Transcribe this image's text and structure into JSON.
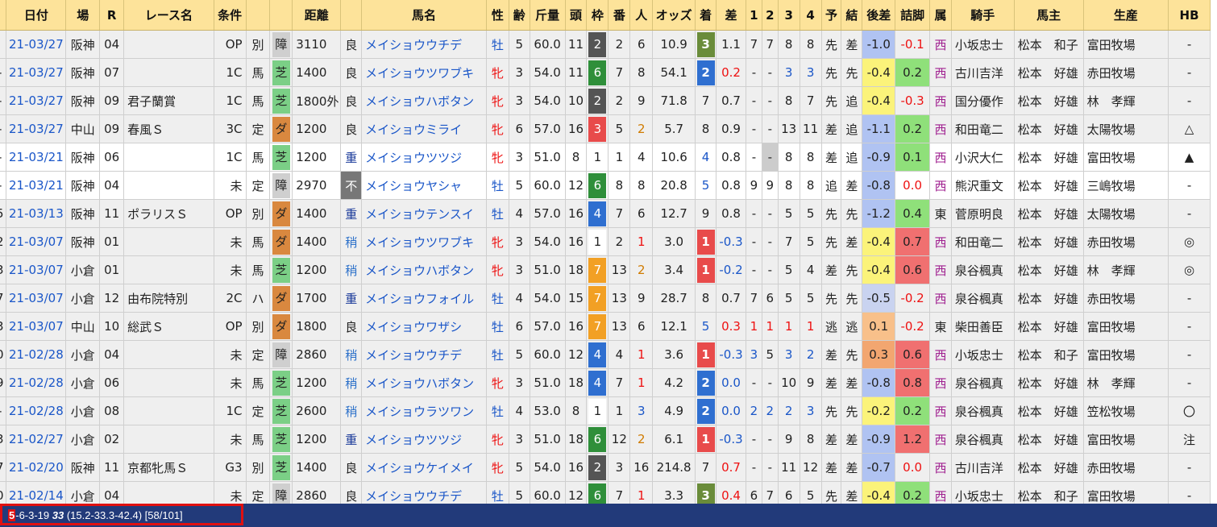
{
  "headers": [
    "",
    "日付",
    "場",
    "R",
    "レース名",
    "条件",
    "",
    "",
    "距離",
    "",
    "馬名",
    "性",
    "齢",
    "斤量",
    "頭",
    "枠",
    "番",
    "人",
    "オッズ",
    "着",
    "差",
    "1",
    "2",
    "3",
    "4",
    "予",
    "結",
    "後差",
    "詰脚",
    "属",
    "騎手",
    "馬主",
    "生産",
    "HB"
  ],
  "colors": {
    "header_bg": "#fde39a",
    "status_bar": "#223a7a",
    "highlight_box": "#e01010",
    "link": "#1a56c8"
  },
  "rows": [
    {
      "p": "",
      "d": "21-03/27",
      "v": "阪神",
      "r": "04",
      "n": "",
      "c": "OP",
      "w": "別",
      "tk": "障",
      "tkt": "jump",
      "dist": "3110",
      "g": "良",
      "h": "メイショウウチデ",
      "s": "牡",
      "a": "5",
      "wt": "60.0",
      "fs": "11",
      "wk": "2",
      "no": "2",
      "pop": "6",
      "odd": "10.9",
      "fin": "3",
      "mg": "1.1",
      "c1": "7",
      "c2": "7",
      "c3": "8",
      "c4": "8",
      "pr": "先",
      "rs": "差",
      "ls": "-1.0",
      "lc": "-0.1",
      "st": "西",
      "j": "小坂忠士",
      "o": "松本　和子",
      "b": "富田牧場",
      "hb": "-"
    },
    {
      "p": "-",
      "d": "21-03/27",
      "v": "阪神",
      "r": "07",
      "n": "",
      "c": "1C",
      "w": "馬",
      "tk": "芝",
      "tkt": "turf",
      "dist": "1400",
      "g": "良",
      "h": "メイショウツワブキ",
      "s": "牝",
      "a": "3",
      "wt": "54.0",
      "fs": "11",
      "wk": "6",
      "no": "7",
      "pop": "8",
      "odd": "54.1",
      "fin": "2",
      "mg": "0.2",
      "c1": "-",
      "c2": "-",
      "c3": "3",
      "c4": "3",
      "pr": "先",
      "rs": "先",
      "ls": "-0.4",
      "lc": "0.2",
      "st": "西",
      "j": "古川吉洋",
      "o": "松本　好雄",
      "b": "赤田牧場",
      "hb": "-"
    },
    {
      "p": "-",
      "d": "21-03/27",
      "v": "阪神",
      "r": "09",
      "n": "君子蘭賞",
      "c": "1C",
      "w": "馬",
      "tk": "芝",
      "tkt": "turf",
      "dist": "1800外",
      "g": "良",
      "h": "メイショウハボタン",
      "s": "牝",
      "a": "3",
      "wt": "54.0",
      "fs": "10",
      "wk": "2",
      "no": "2",
      "pop": "9",
      "odd": "71.8",
      "fin": "7",
      "mg": "0.7",
      "c1": "-",
      "c2": "-",
      "c3": "8",
      "c4": "7",
      "pr": "先",
      "rs": "追",
      "ls": "-0.4",
      "lc": "-0.3",
      "st": "西",
      "j": "国分優作",
      "o": "松本　好雄",
      "b": "林　孝輝",
      "hb": "-"
    },
    {
      "p": "-",
      "d": "21-03/27",
      "v": "中山",
      "r": "09",
      "n": "春風Ｓ",
      "c": "3C",
      "w": "定",
      "tk": "ダ",
      "tkt": "dirt",
      "dist": "1200",
      "g": "良",
      "h": "メイショウミライ",
      "s": "牝",
      "a": "6",
      "wt": "57.0",
      "fs": "16",
      "wk": "3",
      "no": "5",
      "pop": "2",
      "odd": "5.7",
      "fin": "8",
      "mg": "0.9",
      "c1": "-",
      "c2": "-",
      "c3": "13",
      "c4": "11",
      "pr": "差",
      "rs": "追",
      "ls": "-1.1",
      "lc": "0.2",
      "st": "西",
      "j": "和田竜二",
      "o": "松本　好雄",
      "b": "太陽牧場",
      "hb": "△"
    },
    {
      "p": "-",
      "d": "21-03/21",
      "v": "阪神",
      "r": "06",
      "n": "",
      "c": "1C",
      "w": "馬",
      "tk": "芝",
      "tkt": "turf",
      "dist": "1200",
      "g": "重",
      "h": "メイショウツツジ",
      "s": "牝",
      "a": "3",
      "wt": "51.0",
      "fs": "8",
      "wk": "1",
      "no": "1",
      "pop": "4",
      "odd": "10.6",
      "fin": "4",
      "mg": "0.8",
      "c1": "-",
      "c2": "-",
      "c3": "8",
      "c4": "8",
      "pr": "差",
      "rs": "追",
      "ls": "-0.9",
      "lc": "0.1",
      "st": "西",
      "j": "小沢大仁",
      "o": "松本　好雄",
      "b": "富田牧場",
      "hb": "▲"
    },
    {
      "p": "-",
      "d": "21-03/21",
      "v": "阪神",
      "r": "04",
      "n": "",
      "c": "未",
      "w": "定",
      "tk": "障",
      "tkt": "jump",
      "dist": "2970",
      "g": "不",
      "h": "メイショウヤシャ",
      "s": "牡",
      "a": "5",
      "wt": "60.0",
      "fs": "12",
      "wk": "6",
      "no": "8",
      "pop": "8",
      "odd": "20.8",
      "fin": "5",
      "mg": "0.8",
      "c1": "9",
      "c2": "9",
      "c3": "8",
      "c4": "8",
      "pr": "追",
      "rs": "差",
      "ls": "-0.8",
      "lc": "0.0",
      "st": "西",
      "j": "熊沢重文",
      "o": "松本　好雄",
      "b": "三嶋牧場",
      "hb": "-"
    },
    {
      "p": "5",
      "d": "21-03/13",
      "v": "阪神",
      "r": "11",
      "n": "ポラリスＳ",
      "c": "OP",
      "w": "別",
      "tk": "ダ",
      "tkt": "dirt",
      "dist": "1400",
      "g": "重",
      "h": "メイショウテンスイ",
      "s": "牡",
      "a": "4",
      "wt": "57.0",
      "fs": "16",
      "wk": "4",
      "no": "7",
      "pop": "6",
      "odd": "12.7",
      "fin": "9",
      "mg": "0.8",
      "c1": "-",
      "c2": "-",
      "c3": "5",
      "c4": "5",
      "pr": "先",
      "rs": "先",
      "ls": "-1.2",
      "lc": "0.4",
      "st": "東",
      "j": "菅原明良",
      "o": "松本　好雄",
      "b": "太陽牧場",
      "hb": "-"
    },
    {
      "p": "2",
      "d": "21-03/07",
      "v": "阪神",
      "r": "01",
      "n": "",
      "c": "未",
      "w": "馬",
      "tk": "ダ",
      "tkt": "dirt",
      "dist": "1400",
      "g": "稍",
      "h": "メイショウツワブキ",
      "s": "牝",
      "a": "3",
      "wt": "54.0",
      "fs": "16",
      "wk": "1",
      "no": "2",
      "pop": "1",
      "odd": "3.0",
      "fin": "1",
      "mg": "-0.3",
      "c1": "-",
      "c2": "-",
      "c3": "7",
      "c4": "5",
      "pr": "先",
      "rs": "差",
      "ls": "-0.4",
      "lc": "0.7",
      "st": "西",
      "j": "和田竜二",
      "o": "松本　好雄",
      "b": "赤田牧場",
      "hb": "◎"
    },
    {
      "p": "3",
      "d": "21-03/07",
      "v": "小倉",
      "r": "01",
      "n": "",
      "c": "未",
      "w": "馬",
      "tk": "芝",
      "tkt": "turf",
      "dist": "1200",
      "g": "稍",
      "h": "メイショウハボタン",
      "s": "牝",
      "a": "3",
      "wt": "51.0",
      "fs": "18",
      "wk": "7",
      "no": "13",
      "pop": "2",
      "odd": "3.4",
      "fin": "1",
      "mg": "-0.2",
      "c1": "-",
      "c2": "-",
      "c3": "5",
      "c4": "4",
      "pr": "差",
      "rs": "先",
      "ls": "-0.4",
      "lc": "0.6",
      "st": "西",
      "j": "泉谷楓真",
      "o": "松本　好雄",
      "b": "林　孝輝",
      "hb": "◎"
    },
    {
      "p": "7",
      "d": "21-03/07",
      "v": "小倉",
      "r": "12",
      "n": "由布院特別",
      "c": "2C",
      "w": "ハ",
      "tk": "ダ",
      "tkt": "dirt",
      "dist": "1700",
      "g": "重",
      "h": "メイショウフォイル",
      "s": "牡",
      "a": "4",
      "wt": "54.0",
      "fs": "15",
      "wk": "7",
      "no": "13",
      "pop": "9",
      "odd": "28.7",
      "fin": "8",
      "mg": "0.7",
      "c1": "7",
      "c2": "6",
      "c3": "5",
      "c4": "5",
      "pr": "先",
      "rs": "先",
      "ls": "-0.5",
      "lc": "-0.2",
      "st": "西",
      "j": "泉谷楓真",
      "o": "松本　好雄",
      "b": "赤田牧場",
      "hb": "-"
    },
    {
      "p": "3",
      "d": "21-03/07",
      "v": "中山",
      "r": "10",
      "n": "総武Ｓ",
      "c": "OP",
      "w": "別",
      "tk": "ダ",
      "tkt": "dirt",
      "dist": "1800",
      "g": "良",
      "h": "メイショウワザシ",
      "s": "牡",
      "a": "6",
      "wt": "57.0",
      "fs": "16",
      "wk": "7",
      "no": "13",
      "pop": "6",
      "odd": "12.1",
      "fin": "5",
      "mg": "0.3",
      "c1": "1",
      "c2": "1",
      "c3": "1",
      "c4": "1",
      "pr": "逃",
      "rs": "逃",
      "ls": "0.1",
      "lc": "-0.2",
      "st": "東",
      "j": "柴田善臣",
      "o": "松本　好雄",
      "b": "富田牧場",
      "hb": "-"
    },
    {
      "p": "0",
      "d": "21-02/28",
      "v": "小倉",
      "r": "04",
      "n": "",
      "c": "未",
      "w": "定",
      "tk": "障",
      "tkt": "jump",
      "dist": "2860",
      "g": "稍",
      "h": "メイショウウチデ",
      "s": "牡",
      "a": "5",
      "wt": "60.0",
      "fs": "12",
      "wk": "4",
      "no": "4",
      "pop": "1",
      "odd": "3.6",
      "fin": "1",
      "mg": "-0.3",
      "c1": "3",
      "c2": "5",
      "c3": "3",
      "c4": "2",
      "pr": "差",
      "rs": "先",
      "ls": "0.3",
      "lc": "0.6",
      "st": "西",
      "j": "小坂忠士",
      "o": "松本　和子",
      "b": "富田牧場",
      "hb": "-"
    },
    {
      "p": "9",
      "d": "21-02/28",
      "v": "小倉",
      "r": "06",
      "n": "",
      "c": "未",
      "w": "馬",
      "tk": "芝",
      "tkt": "turf",
      "dist": "1200",
      "g": "稍",
      "h": "メイショウハボタン",
      "s": "牝",
      "a": "3",
      "wt": "51.0",
      "fs": "18",
      "wk": "4",
      "no": "7",
      "pop": "1",
      "odd": "4.2",
      "fin": "2",
      "mg": "0.0",
      "c1": "-",
      "c2": "-",
      "c3": "10",
      "c4": "9",
      "pr": "差",
      "rs": "差",
      "ls": "-0.8",
      "lc": "0.8",
      "st": "西",
      "j": "泉谷楓真",
      "o": "松本　好雄",
      "b": "林　孝輝",
      "hb": "-"
    },
    {
      "p": "-",
      "d": "21-02/28",
      "v": "小倉",
      "r": "08",
      "n": "",
      "c": "1C",
      "w": "定",
      "tk": "芝",
      "tkt": "turf",
      "dist": "2600",
      "g": "稍",
      "h": "メイショウラツワン",
      "s": "牡",
      "a": "4",
      "wt": "53.0",
      "fs": "8",
      "wk": "1",
      "no": "1",
      "pop": "3",
      "odd": "4.9",
      "fin": "2",
      "mg": "0.0",
      "c1": "2",
      "c2": "2",
      "c3": "2",
      "c4": "3",
      "pr": "先",
      "rs": "先",
      "ls": "-0.2",
      "lc": "0.2",
      "st": "西",
      "j": "泉谷楓真",
      "o": "松本　好雄",
      "b": "笠松牧場",
      "hb": "〇"
    },
    {
      "p": "3",
      "d": "21-02/27",
      "v": "小倉",
      "r": "02",
      "n": "",
      "c": "未",
      "w": "馬",
      "tk": "芝",
      "tkt": "turf",
      "dist": "1200",
      "g": "重",
      "h": "メイショウツツジ",
      "s": "牝",
      "a": "3",
      "wt": "51.0",
      "fs": "18",
      "wk": "6",
      "no": "12",
      "pop": "2",
      "odd": "6.1",
      "fin": "1",
      "mg": "-0.3",
      "c1": "-",
      "c2": "-",
      "c3": "9",
      "c4": "8",
      "pr": "差",
      "rs": "差",
      "ls": "-0.9",
      "lc": "1.2",
      "st": "西",
      "j": "泉谷楓真",
      "o": "松本　好雄",
      "b": "富田牧場",
      "hb": "注"
    },
    {
      "p": "7",
      "d": "21-02/20",
      "v": "阪神",
      "r": "11",
      "n": "京都牝馬Ｓ",
      "c": "G3",
      "w": "別",
      "tk": "芝",
      "tkt": "turf",
      "dist": "1400",
      "g": "良",
      "h": "メイショウケイメイ",
      "s": "牝",
      "a": "5",
      "wt": "54.0",
      "fs": "16",
      "wk": "2",
      "no": "3",
      "pop": "16",
      "odd": "214.8",
      "fin": "7",
      "mg": "0.7",
      "c1": "-",
      "c2": "-",
      "c3": "11",
      "c4": "12",
      "pr": "差",
      "rs": "差",
      "ls": "-0.7",
      "lc": "0.0",
      "st": "西",
      "j": "古川吉洋",
      "o": "松本　好雄",
      "b": "赤田牧場",
      "hb": "-"
    },
    {
      "p": "0",
      "d": "21-02/14",
      "v": "小倉",
      "r": "04",
      "n": "",
      "c": "未",
      "w": "定",
      "tk": "障",
      "tkt": "jump",
      "dist": "2860",
      "g": "良",
      "h": "メイショウウチデ",
      "s": "牡",
      "a": "5",
      "wt": "60.0",
      "fs": "12",
      "wk": "6",
      "no": "7",
      "pop": "1",
      "odd": "3.3",
      "fin": "3",
      "mg": "0.4",
      "c1": "6",
      "c2": "7",
      "c3": "6",
      "c4": "5",
      "pr": "先",
      "rs": "差",
      "ls": "-0.4",
      "lc": "0.2",
      "st": "西",
      "j": "小坂忠士",
      "o": "松本　和子",
      "b": "富田牧場",
      "hb": "-"
    }
  ],
  "status": {
    "wins": "5",
    "rest": "-6-3-19 ",
    "score": "33",
    "detail": " (15.2-33.3-42.4) [58/101]"
  }
}
